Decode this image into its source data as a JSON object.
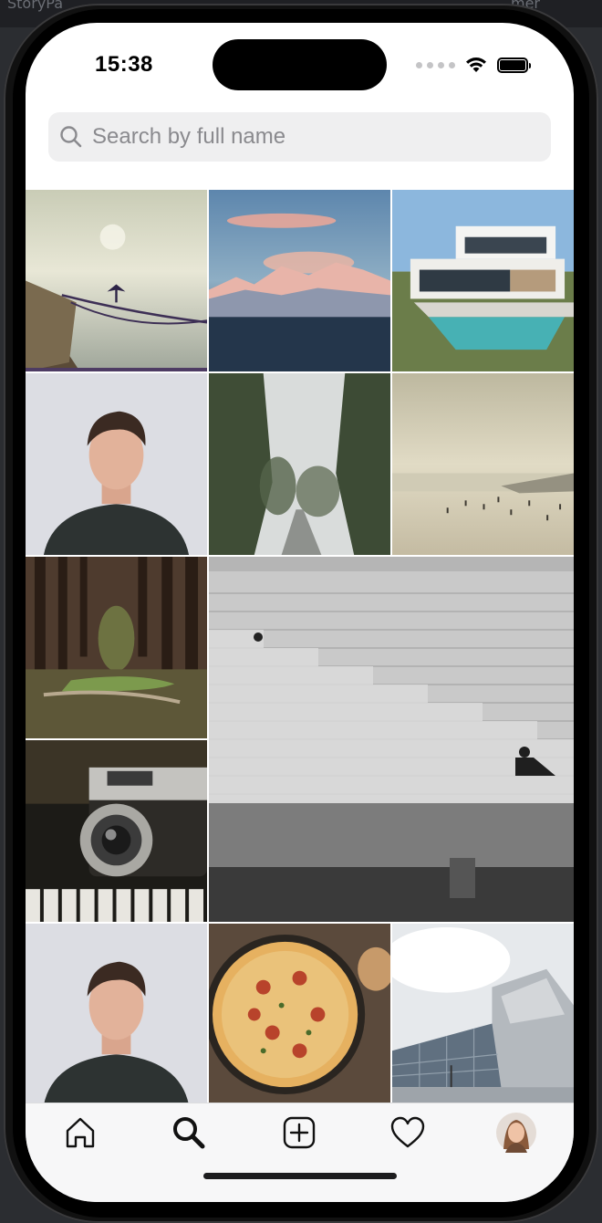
{
  "background": {
    "left_text": "StoryPa",
    "right_text": "mer"
  },
  "status_bar": {
    "time": "15:38"
  },
  "search": {
    "placeholder": "Search by full name",
    "value": ""
  },
  "grid": {
    "tiles": [
      {
        "name": "photo-pier-cormorant",
        "subject": "Cormorant on pier post over water"
      },
      {
        "name": "photo-mountains-sunset",
        "subject": "Snowy mountain range at sunset"
      },
      {
        "name": "photo-modern-house",
        "subject": "Modern house with swimming pool"
      },
      {
        "name": "photo-portrait-man",
        "subject": "Portrait of a young man"
      },
      {
        "name": "photo-foggy-road",
        "subject": "Foggy road lined with trees"
      },
      {
        "name": "photo-beach",
        "subject": "Hazy beach with people"
      },
      {
        "name": "photo-forest-path",
        "subject": "Forest path among tall trees"
      },
      {
        "name": "photo-stone-wall-stairs",
        "subject": "Stone wall with stairs, black and white"
      },
      {
        "name": "photo-vintage-camera",
        "subject": "Vintage camera"
      },
      {
        "name": "photo-portrait-man-2",
        "subject": "Portrait of a young man"
      },
      {
        "name": "photo-pizza",
        "subject": "Pizza on wooden board"
      },
      {
        "name": "photo-building",
        "subject": "Modern angular building"
      }
    ]
  },
  "tab_bar": {
    "items": [
      {
        "name": "home",
        "icon": "home-icon"
      },
      {
        "name": "search",
        "icon": "search-icon",
        "active": true
      },
      {
        "name": "create",
        "icon": "plus-square-icon"
      },
      {
        "name": "activity",
        "icon": "heart-icon"
      },
      {
        "name": "profile",
        "icon": "avatar"
      }
    ]
  }
}
